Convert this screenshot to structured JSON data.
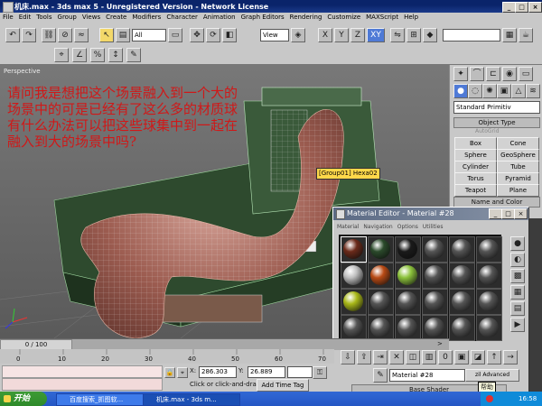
{
  "window": {
    "title": "机床.max - 3ds max 5 - Unregistered Version - Network License",
    "minimize": "_",
    "maximize": "□",
    "close": "×"
  },
  "menu": [
    "File",
    "Edit",
    "Tools",
    "Group",
    "Views",
    "Create",
    "Modifiers",
    "Character",
    "Animation",
    "Graph Editors",
    "Rendering",
    "Customize",
    "MAXScript",
    "Help"
  ],
  "toolbar": {
    "selection_filter": "All",
    "ref_coord": "View",
    "axis_constraints": [
      "X",
      "Y",
      "Z",
      "XY"
    ]
  },
  "viewport": {
    "label": "Perspective",
    "question_text": "请问我是想把这个场景融入到一个大的场景中的可是已经有了这么多的材质球有什么办法可以把这些球集中到一起在融入到大的场景中吗?",
    "object_tag": "[Group01] Hexa02",
    "colors": {
      "question": "#d01818",
      "tag_bg": "#ffd84a"
    }
  },
  "command_panel": {
    "category": "Standard Primitiv",
    "rollout_object_type": "Object Type",
    "autogrid": "AutoGrid",
    "primitives": [
      "Box",
      "Cone",
      "Sphere",
      "GeoSphere",
      "Cylinder",
      "Tube",
      "Torus",
      "Pyramid",
      "Teapot",
      "Plane"
    ],
    "rollout_name_color": "Name and Color"
  },
  "material_editor": {
    "title": "Material Editor - Material #28",
    "menu": [
      "Material",
      "Navigation",
      "Options",
      "Utilities"
    ],
    "material_name": "Material #28",
    "type_button": "zil Advanced",
    "rollout": "Base Shader",
    "tooltip": "帮助",
    "slot_colors": [
      "#6b2a1a",
      "#2b4a2b",
      "#1a1a1a",
      "#555555",
      "#555555",
      "#555555",
      "#bfbfbf",
      "#b84a14",
      "#8cc23c",
      "#555555",
      "#555555",
      "#555555",
      "#a9b818",
      "#555555",
      "#555555",
      "#555555",
      "#555555",
      "#555555",
      "#555555",
      "#555555",
      "#555555",
      "#555555",
      "#555555",
      "#555555"
    ]
  },
  "timeline": {
    "frame_readout": "0 / 100",
    "ticks": [
      "0",
      "10",
      "20",
      "30",
      "40",
      "50",
      "60",
      "70"
    ]
  },
  "status": {
    "x_label": "X:",
    "x_value": "286.303",
    "y_label": "Y:",
    "y_value": "26.889",
    "prompt": "Click or click-and-drag",
    "add_time_tag": "Add Time Tag"
  },
  "taskbar": {
    "start": "开始",
    "items": [
      "百度搜索_抓图软...",
      "机床.max - 3ds m..."
    ],
    "clock": "16:58"
  }
}
